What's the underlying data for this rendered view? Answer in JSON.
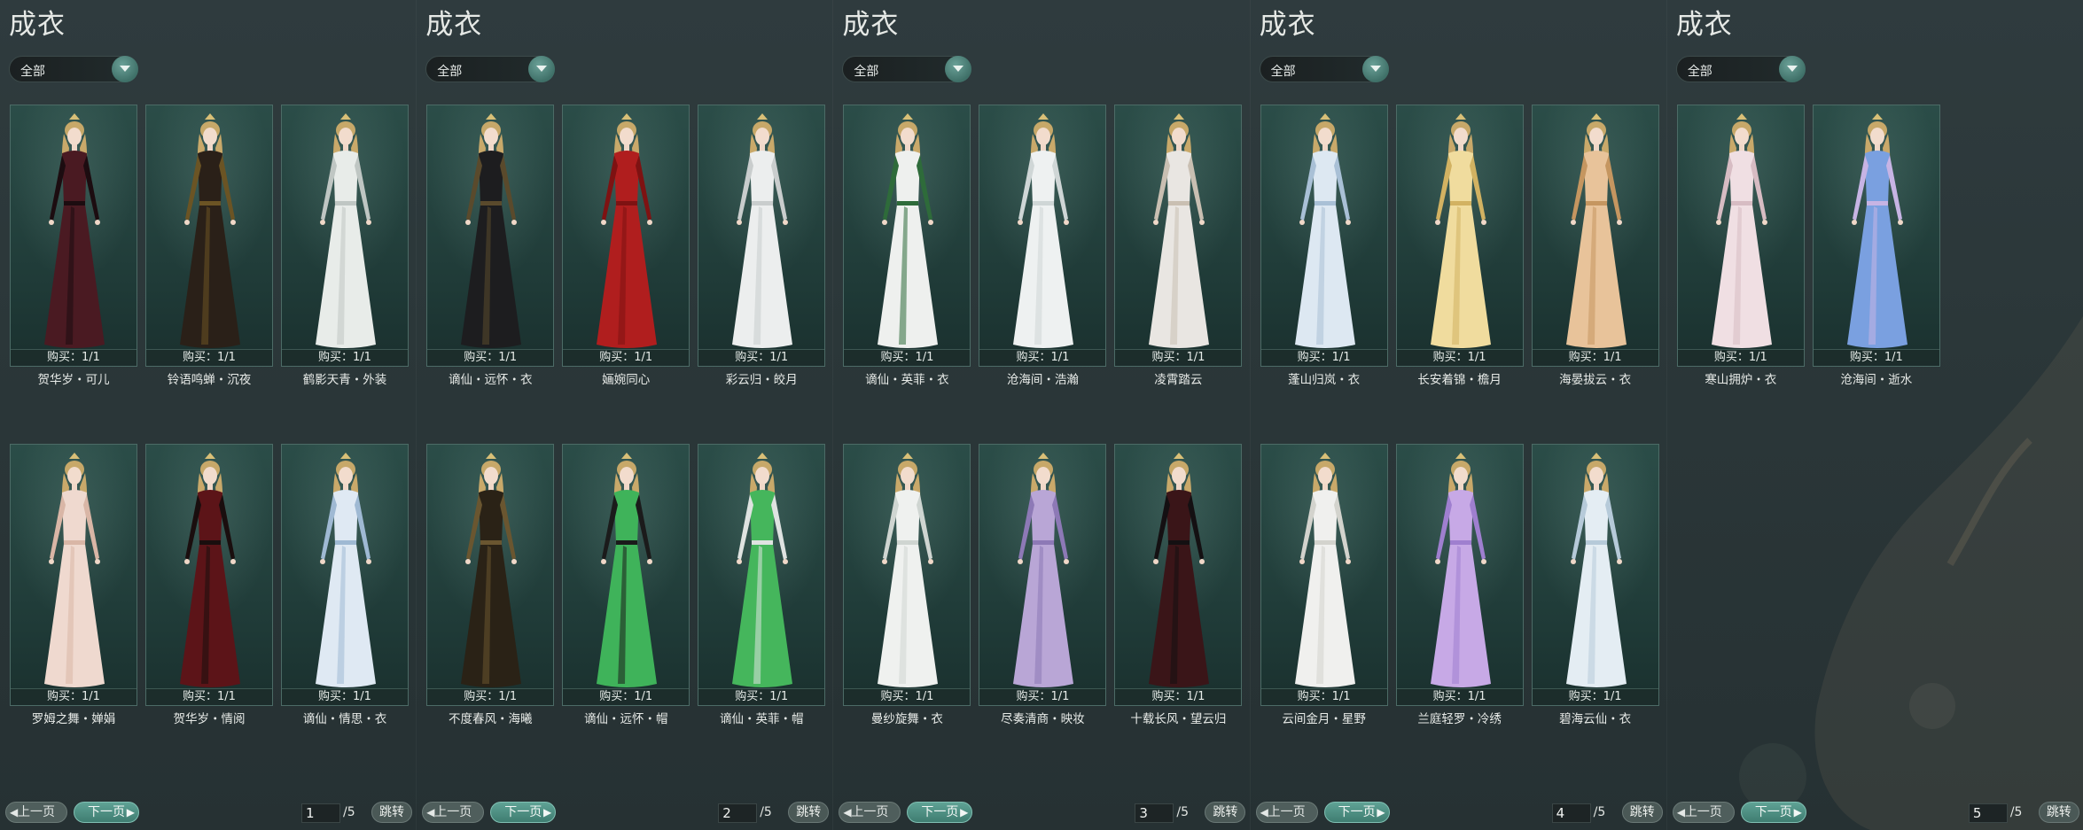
{
  "panels": [
    {
      "title": "成衣",
      "filter": "全部",
      "items": [
        {
          "buy": "购买：1/1",
          "name": "贺华岁・可儿",
          "dress": "#4a1a22",
          "accent": "#1c0c10"
        },
        {
          "buy": "购买：1/1",
          "name": "铃语鸣蝉・沉夜",
          "dress": "#2a2018",
          "accent": "#6b5424"
        },
        {
          "buy": "购买：1/1",
          "name": "鹤影天青・外装",
          "dress": "#e8ece9",
          "accent": "#bfc6c3"
        },
        {
          "buy": "购买：1/1",
          "name": "罗姆之舞・婵娟",
          "dress": "#efd9cf",
          "accent": "#d9b6a6"
        },
        {
          "buy": "购买：1/1",
          "name": "贺华岁・情阅",
          "dress": "#5c1418",
          "accent": "#1a0e0e"
        },
        {
          "buy": "购买：1/1",
          "name": "谪仙・情思・衣",
          "dress": "#dfe9f3",
          "accent": "#9fb9d3"
        }
      ],
      "prev": "上一页",
      "next": "下一页",
      "page": "1",
      "total": "/5",
      "jump": "跳转"
    },
    {
      "title": "成衣",
      "filter": "全部",
      "items": [
        {
          "buy": "购买：1/1",
          "name": "谪仙・远怀・衣",
          "dress": "#1d1d1f",
          "accent": "#5a4a2c"
        },
        {
          "buy": "购买：1/1",
          "name": "婳婉同心",
          "dress": "#b01e1e",
          "accent": "#7e1212"
        },
        {
          "buy": "购买：1/1",
          "name": "彩云归・皎月",
          "dress": "#eceeee",
          "accent": "#c9cdcd"
        },
        {
          "buy": "购买：1/1",
          "name": "不度春风・海曦",
          "dress": "#2a2216",
          "accent": "#6a5630"
        },
        {
          "buy": "购买：1/1",
          "name": "谪仙・远怀・帽",
          "dress": "#3fb35a",
          "accent": "#1b1b1b"
        },
        {
          "buy": "购买：1/1",
          "name": "谪仙・英菲・帽",
          "dress": "#45b65c",
          "accent": "#dfe3e1"
        }
      ],
      "prev": "上一页",
      "next": "下一页",
      "page": "2",
      "total": "/5",
      "jump": "跳转"
    },
    {
      "title": "成衣",
      "filter": "全部",
      "items": [
        {
          "buy": "购买：1/1",
          "name": "谪仙・英菲・衣",
          "dress": "#eef0ee",
          "accent": "#2e6b3a"
        },
        {
          "buy": "购买：1/1",
          "name": "沧海间・浩瀚",
          "dress": "#eef1f1",
          "accent": "#cfd6d6"
        },
        {
          "buy": "购买：1/1",
          "name": "凌霄踏云",
          "dress": "#e9e6e2",
          "accent": "#c9bfb2"
        },
        {
          "buy": "购买：1/1",
          "name": "曼纱旋舞・衣",
          "dress": "#eff1ef",
          "accent": "#cfd5d1"
        },
        {
          "buy": "购买：1/1",
          "name": "尽奏清商・映妆",
          "dress": "#b9a6d6",
          "accent": "#8d79b6"
        },
        {
          "buy": "购买：1/1",
          "name": "十载长风・望云归",
          "dress": "#3a1518",
          "accent": "#141012"
        }
      ],
      "prev": "上一页",
      "next": "下一页",
      "page": "3",
      "total": "/5",
      "jump": "跳转"
    },
    {
      "title": "成衣",
      "filter": "全部",
      "items": [
        {
          "buy": "购买：1/1",
          "name": "蓬山归岚・衣",
          "dress": "#dde8f2",
          "accent": "#a9c0d6"
        },
        {
          "buy": "购买：1/1",
          "name": "长安着锦・檐月",
          "dress": "#f0dc9e",
          "accent": "#d2b262"
        },
        {
          "buy": "购买：1/1",
          "name": "海晏拔云・衣",
          "dress": "#e8c39a",
          "accent": "#c59660"
        },
        {
          "buy": "购买：1/1",
          "name": "云间金月・星野",
          "dress": "#f0f0ee",
          "accent": "#d3d3cd"
        },
        {
          "buy": "购买：1/1",
          "name": "兰庭轻罗・冷绣",
          "dress": "#c7a9e6",
          "accent": "#9f7fcf"
        },
        {
          "buy": "购买：1/1",
          "name": "碧海云仙・衣",
          "dress": "#e4edf3",
          "accent": "#b6cad9"
        }
      ],
      "prev": "上一页",
      "next": "下一页",
      "page": "4",
      "total": "/5",
      "jump": "跳转"
    },
    {
      "title": "成衣",
      "filter": "全部",
      "items": [
        {
          "buy": "购买：1/1",
          "name": "寒山拥炉・衣",
          "dress": "#f0dfe3",
          "accent": "#d7bcc3"
        },
        {
          "buy": "购买：1/1",
          "name": "沧海间・逝水",
          "dress": "#7aa0e0",
          "accent": "#c7b4e4"
        }
      ],
      "prev": "上一页",
      "next": "下一页",
      "page": "5",
      "total": "/5",
      "jump": "跳转"
    }
  ]
}
